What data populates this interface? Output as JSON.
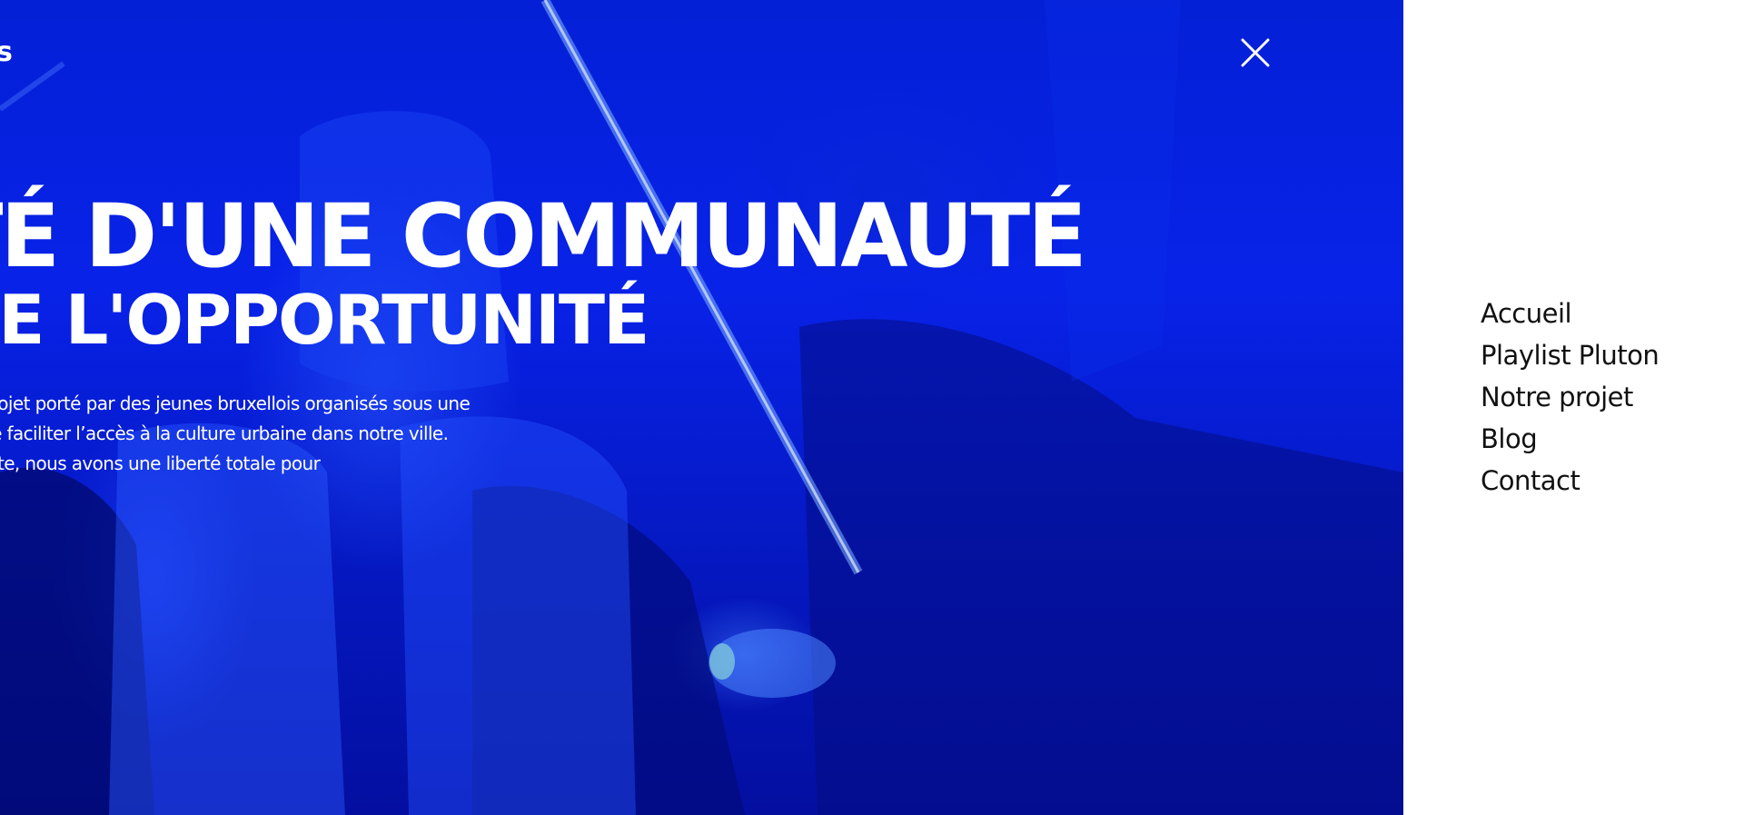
{
  "hero": {
    "brand_fragment": "s",
    "headline_line1": "TÉ D'UNE COMMUNAUTÉ",
    "headline_line2": "DE L'OPPORTUNITÉ",
    "intro_lines": [
      "projet porté par des jeunes bruxellois organisés sous une",
      "de faciliter l’accès à la culture urbaine dans notre ville.",
      "tête, nous avons une liberté totale pour"
    ],
    "background_color": "#0420d6"
  },
  "close_icon": "close-icon",
  "menu": {
    "items": [
      {
        "label": "Accueil"
      },
      {
        "label": "Playlist Pluton"
      },
      {
        "label": "Notre projet"
      },
      {
        "label": "Blog"
      },
      {
        "label": "Contact"
      }
    ]
  }
}
